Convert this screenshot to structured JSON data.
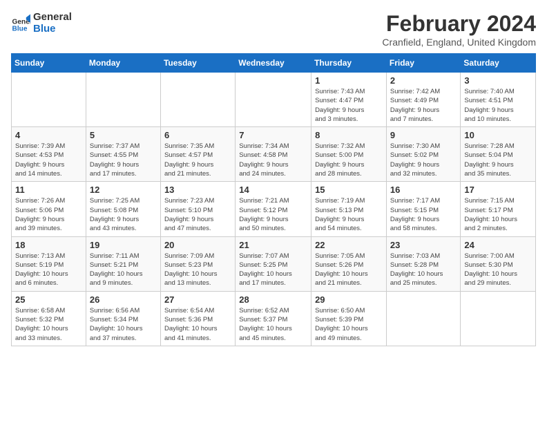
{
  "header": {
    "logo_line1": "General",
    "logo_line2": "Blue",
    "month_year": "February 2024",
    "location": "Cranfield, England, United Kingdom"
  },
  "weekdays": [
    "Sunday",
    "Monday",
    "Tuesday",
    "Wednesday",
    "Thursday",
    "Friday",
    "Saturday"
  ],
  "weeks": [
    [
      {
        "day": "",
        "info": ""
      },
      {
        "day": "",
        "info": ""
      },
      {
        "day": "",
        "info": ""
      },
      {
        "day": "",
        "info": ""
      },
      {
        "day": "1",
        "info": "Sunrise: 7:43 AM\nSunset: 4:47 PM\nDaylight: 9 hours\nand 3 minutes."
      },
      {
        "day": "2",
        "info": "Sunrise: 7:42 AM\nSunset: 4:49 PM\nDaylight: 9 hours\nand 7 minutes."
      },
      {
        "day": "3",
        "info": "Sunrise: 7:40 AM\nSunset: 4:51 PM\nDaylight: 9 hours\nand 10 minutes."
      }
    ],
    [
      {
        "day": "4",
        "info": "Sunrise: 7:39 AM\nSunset: 4:53 PM\nDaylight: 9 hours\nand 14 minutes."
      },
      {
        "day": "5",
        "info": "Sunrise: 7:37 AM\nSunset: 4:55 PM\nDaylight: 9 hours\nand 17 minutes."
      },
      {
        "day": "6",
        "info": "Sunrise: 7:35 AM\nSunset: 4:57 PM\nDaylight: 9 hours\nand 21 minutes."
      },
      {
        "day": "7",
        "info": "Sunrise: 7:34 AM\nSunset: 4:58 PM\nDaylight: 9 hours\nand 24 minutes."
      },
      {
        "day": "8",
        "info": "Sunrise: 7:32 AM\nSunset: 5:00 PM\nDaylight: 9 hours\nand 28 minutes."
      },
      {
        "day": "9",
        "info": "Sunrise: 7:30 AM\nSunset: 5:02 PM\nDaylight: 9 hours\nand 32 minutes."
      },
      {
        "day": "10",
        "info": "Sunrise: 7:28 AM\nSunset: 5:04 PM\nDaylight: 9 hours\nand 35 minutes."
      }
    ],
    [
      {
        "day": "11",
        "info": "Sunrise: 7:26 AM\nSunset: 5:06 PM\nDaylight: 9 hours\nand 39 minutes."
      },
      {
        "day": "12",
        "info": "Sunrise: 7:25 AM\nSunset: 5:08 PM\nDaylight: 9 hours\nand 43 minutes."
      },
      {
        "day": "13",
        "info": "Sunrise: 7:23 AM\nSunset: 5:10 PM\nDaylight: 9 hours\nand 47 minutes."
      },
      {
        "day": "14",
        "info": "Sunrise: 7:21 AM\nSunset: 5:12 PM\nDaylight: 9 hours\nand 50 minutes."
      },
      {
        "day": "15",
        "info": "Sunrise: 7:19 AM\nSunset: 5:13 PM\nDaylight: 9 hours\nand 54 minutes."
      },
      {
        "day": "16",
        "info": "Sunrise: 7:17 AM\nSunset: 5:15 PM\nDaylight: 9 hours\nand 58 minutes."
      },
      {
        "day": "17",
        "info": "Sunrise: 7:15 AM\nSunset: 5:17 PM\nDaylight: 10 hours\nand 2 minutes."
      }
    ],
    [
      {
        "day": "18",
        "info": "Sunrise: 7:13 AM\nSunset: 5:19 PM\nDaylight: 10 hours\nand 6 minutes."
      },
      {
        "day": "19",
        "info": "Sunrise: 7:11 AM\nSunset: 5:21 PM\nDaylight: 10 hours\nand 9 minutes."
      },
      {
        "day": "20",
        "info": "Sunrise: 7:09 AM\nSunset: 5:23 PM\nDaylight: 10 hours\nand 13 minutes."
      },
      {
        "day": "21",
        "info": "Sunrise: 7:07 AM\nSunset: 5:25 PM\nDaylight: 10 hours\nand 17 minutes."
      },
      {
        "day": "22",
        "info": "Sunrise: 7:05 AM\nSunset: 5:26 PM\nDaylight: 10 hours\nand 21 minutes."
      },
      {
        "day": "23",
        "info": "Sunrise: 7:03 AM\nSunset: 5:28 PM\nDaylight: 10 hours\nand 25 minutes."
      },
      {
        "day": "24",
        "info": "Sunrise: 7:00 AM\nSunset: 5:30 PM\nDaylight: 10 hours\nand 29 minutes."
      }
    ],
    [
      {
        "day": "25",
        "info": "Sunrise: 6:58 AM\nSunset: 5:32 PM\nDaylight: 10 hours\nand 33 minutes."
      },
      {
        "day": "26",
        "info": "Sunrise: 6:56 AM\nSunset: 5:34 PM\nDaylight: 10 hours\nand 37 minutes."
      },
      {
        "day": "27",
        "info": "Sunrise: 6:54 AM\nSunset: 5:36 PM\nDaylight: 10 hours\nand 41 minutes."
      },
      {
        "day": "28",
        "info": "Sunrise: 6:52 AM\nSunset: 5:37 PM\nDaylight: 10 hours\nand 45 minutes."
      },
      {
        "day": "29",
        "info": "Sunrise: 6:50 AM\nSunset: 5:39 PM\nDaylight: 10 hours\nand 49 minutes."
      },
      {
        "day": "",
        "info": ""
      },
      {
        "day": "",
        "info": ""
      }
    ]
  ]
}
